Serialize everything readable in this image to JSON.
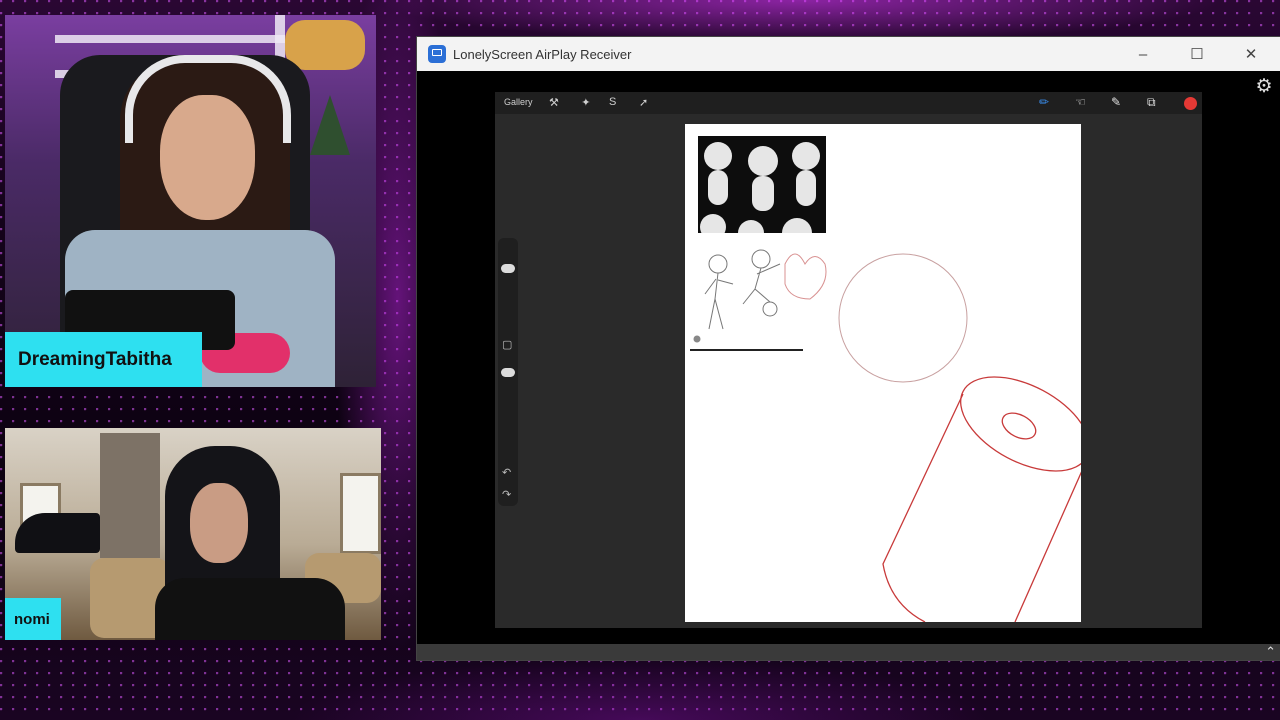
{
  "webcam_top": {
    "name": "DreamingTabitha"
  },
  "webcam_bottom": {
    "name": "nomi"
  },
  "window": {
    "title": "LonelyScreen AirPlay Receiver",
    "minimize_icon": "minimize-icon",
    "maximize_icon": "maximize-icon",
    "close_icon": "close-icon",
    "settings_icon": "gear-icon"
  },
  "procreate": {
    "gallery_label": "Gallery",
    "left_tools": [
      "wrench-icon",
      "magic-wand-icon",
      "selection-icon",
      "transform-icon"
    ],
    "right_tools": [
      "brush-icon",
      "smudge-icon",
      "eraser-icon",
      "layers-icon"
    ],
    "current_color": "#e53935"
  },
  "colors": {
    "nametag": "#2ee0f0",
    "accent": "#c040ff"
  }
}
